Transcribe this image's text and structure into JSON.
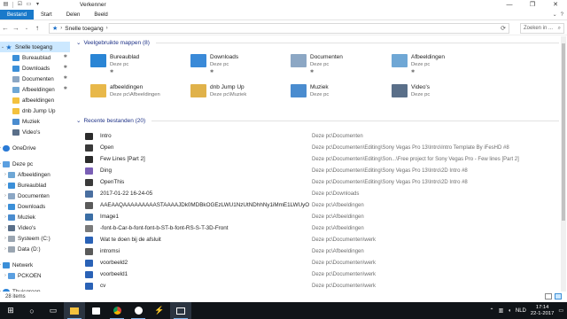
{
  "window": {
    "title": "Verkenner",
    "controls": [
      "—",
      "❐",
      "✕"
    ]
  },
  "ribbon": {
    "tabs": [
      "Bestand",
      "Start",
      "Delen",
      "Beeld"
    ]
  },
  "address": {
    "crumb": "Snelle toegang",
    "search_placeholder": "Zoeken in ..."
  },
  "sidebar": {
    "items": [
      {
        "label": "Snelle toegang",
        "icon": "star-icon",
        "pinned": false
      },
      {
        "label": "Bureaublad",
        "icon": "desktop-folder-icon",
        "pinned": true
      },
      {
        "label": "Downloads",
        "icon": "downloads-folder-icon",
        "pinned": true
      },
      {
        "label": "Documenten",
        "icon": "documents-folder-icon",
        "pinned": true
      },
      {
        "label": "Afbeeldingen",
        "icon": "pictures-folder-icon",
        "pinned": true
      },
      {
        "label": "afbeeldingen",
        "icon": "folder-icon",
        "pinned": false
      },
      {
        "label": "dnb Jump Up",
        "icon": "folder-icon",
        "pinned": false
      },
      {
        "label": "Muziek",
        "icon": "music-folder-icon",
        "pinned": false
      },
      {
        "label": "Video's",
        "icon": "video-folder-icon",
        "pinned": false
      },
      {
        "label": "OneDrive",
        "icon": "cloud-icon",
        "pinned": false
      },
      {
        "label": "Deze pc",
        "icon": "pc-icon",
        "pinned": false
      },
      {
        "label": "Afbeeldingen",
        "icon": "pictures-folder-icon",
        "pinned": false
      },
      {
        "label": "Bureaublad",
        "icon": "desktop-folder-icon",
        "pinned": false
      },
      {
        "label": "Documenten",
        "icon": "documents-folder-icon",
        "pinned": false
      },
      {
        "label": "Downloads",
        "icon": "downloads-folder-icon",
        "pinned": false
      },
      {
        "label": "Muziek",
        "icon": "music-folder-icon",
        "pinned": false
      },
      {
        "label": "Video's",
        "icon": "video-folder-icon",
        "pinned": false
      },
      {
        "label": "Systeem (C:)",
        "icon": "drive-icon",
        "pinned": false
      },
      {
        "label": "Data (D:)",
        "icon": "drive-icon",
        "pinned": false
      },
      {
        "label": "Netwerk",
        "icon": "network-icon",
        "pinned": false
      },
      {
        "label": "PCKOEN",
        "icon": "pc-icon",
        "pinned": false
      },
      {
        "label": "Thuisgroep",
        "icon": "homegroup-icon",
        "pinned": false
      }
    ]
  },
  "frequent": {
    "header": "Veelgebruikte mappen (8)",
    "folders": [
      {
        "name": "Bureaublad",
        "location": "Deze pc",
        "pin": "✱"
      },
      {
        "name": "Downloads",
        "location": "Deze pc",
        "pin": "✱"
      },
      {
        "name": "Documenten",
        "location": "Deze pc",
        "pin": "✱"
      },
      {
        "name": "Afbeeldingen",
        "location": "Deze pc",
        "pin": "✱"
      },
      {
        "name": "afbeeldingen",
        "location": "Deze pc\\Afbeeldingen",
        "pin": ""
      },
      {
        "name": "dnb Jump Up",
        "location": "Deze pc\\Muziek",
        "pin": ""
      },
      {
        "name": "Muziek",
        "location": "Deze pc",
        "pin": ""
      },
      {
        "name": "Video's",
        "location": "Deze pc",
        "pin": ""
      }
    ]
  },
  "recent": {
    "header": "Recente bestanden (20)",
    "files": [
      {
        "name": "Intro",
        "path": "Deze pc\\Documenten"
      },
      {
        "name": "Open",
        "path": "Deze pc\\Documenten\\Editing\\Sony Vegas Pro 13\\Intro\\Intro Template By iFesHD #8"
      },
      {
        "name": "Few Lines [Part 2]",
        "path": "Deze pc\\Documenten\\Editing\\Son...\\Free project for Sony Vegas Pro - Few lines [Part 2]"
      },
      {
        "name": "Ding",
        "path": "Deze pc\\Documenten\\Editing\\Sony Vegas Pro 13\\Intro\\2D Intro #8"
      },
      {
        "name": "OpenThis",
        "path": "Deze pc\\Documenten\\Editing\\Sony Vegas Pro 13\\Intro\\2D Intro #8"
      },
      {
        "name": "2017-01-22 16-24-05",
        "path": "Deze pc\\Downloads"
      },
      {
        "name": "AAEAAQAAAAAAAAASTAAAAJDk0MDBkOGEzLWU1NzUtNDhhNy1iMmE1LWUyOWWm...",
        "path": "Deze pc\\Afbeeldingen"
      },
      {
        "name": "Image1",
        "path": "Deze pc\\Afbeeldingen"
      },
      {
        "name": "-font-b-Car-b-font-font-b-ST-b-font-RS-S-T-3D-Front",
        "path": "Deze pc\\Afbeeldingen"
      },
      {
        "name": "Wat te doen bij de afsluit",
        "path": "Deze pc\\Documenten\\werk"
      },
      {
        "name": "intromsi",
        "path": "Deze pc\\Afbeeldingen"
      },
      {
        "name": "voorbeeld2",
        "path": "Deze pc\\Documenten\\werk"
      },
      {
        "name": "voorbeeld1",
        "path": "Deze pc\\Documenten\\werk"
      },
      {
        "name": "cv",
        "path": "Deze pc\\Documenten\\werk"
      }
    ]
  },
  "status": {
    "count": "28 items"
  },
  "tray": {
    "language": "NLD",
    "time": "17:14",
    "date": "22-1-2017"
  },
  "colors": {
    "accent": "#1979ca",
    "selection": "#cce8ff",
    "header_text": "#1e3287",
    "taskbar": "#101418"
  }
}
